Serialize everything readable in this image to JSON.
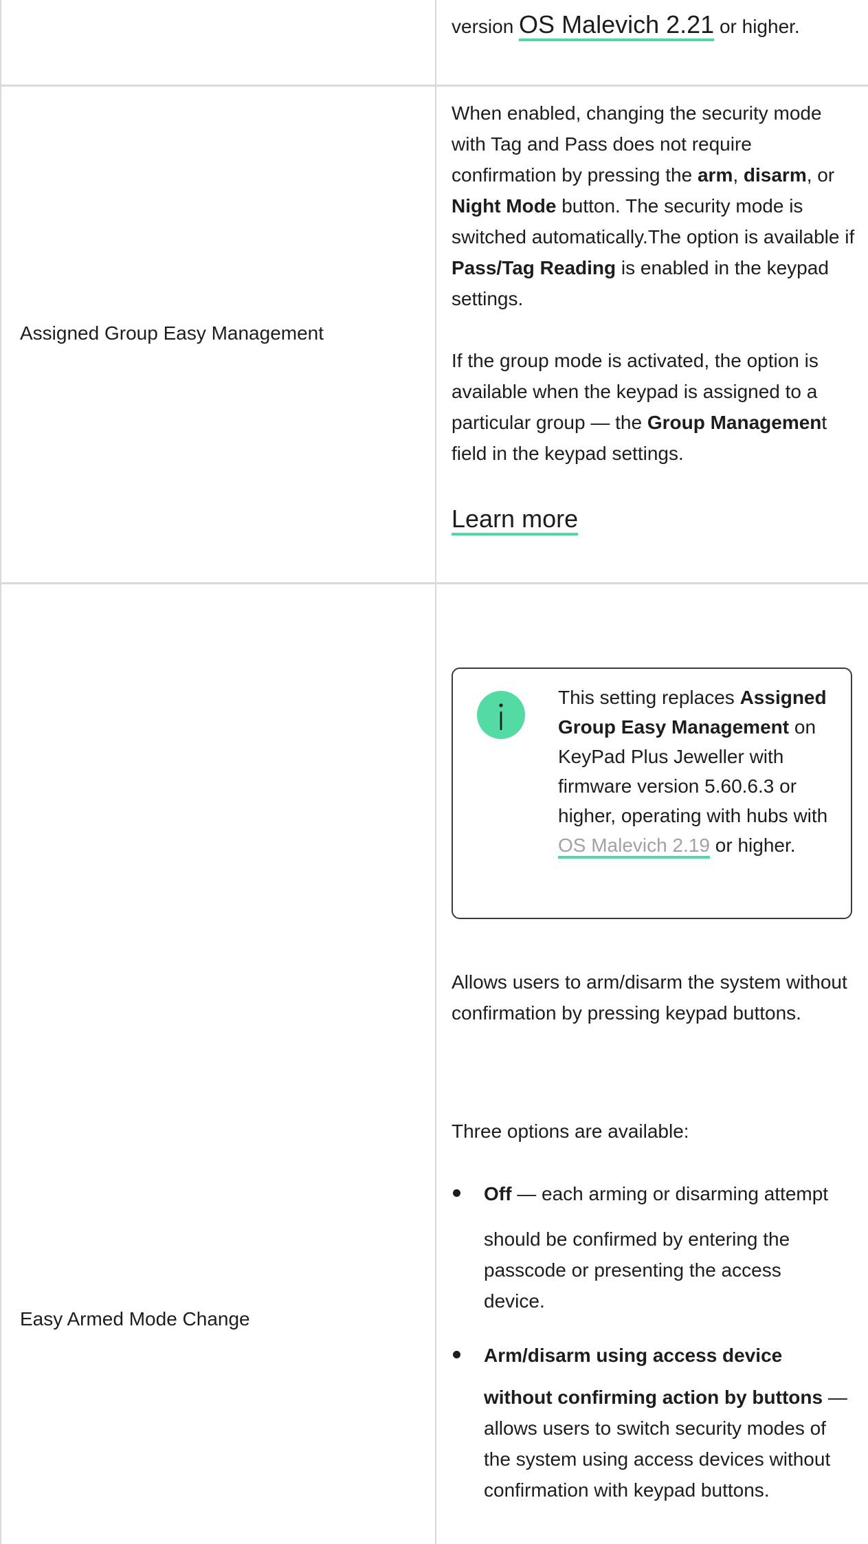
{
  "row1": {
    "prefix": "version ",
    "link": "OS Malevich 2.21",
    "suffix": " or higher."
  },
  "row2": {
    "label": "Assigned Group Easy Management",
    "p1": {
      "t1": "When enabled, changing the security mode with Tag and Pass does not require confirmation by pressing the ",
      "b1": "arm",
      "t2": ", ",
      "b2": "disarm",
      "t3": ", or ",
      "b3": "Night Mode",
      "t4": " button. The security mode is switched automatically.The option is available if ",
      "b4": "Pass/Tag Reading",
      "t5": " is enabled in the keypad settings."
    },
    "p2": {
      "t1": "If the group mode is activated, the option is available when the keypad is assigned to a particular group — the ",
      "b1": "Group Managemen",
      "t2": "t field in the keypad settings."
    },
    "learn_more": "Learn more"
  },
  "row3": {
    "label": "Easy Armed Mode Change",
    "note": {
      "icon": "info-icon",
      "accent_color": "#54dba3",
      "t1": "This setting replaces ",
      "b1": "Assigned Group Easy Management",
      "t2": " on KeyPad Plus Jeweller with firmware version 5.60.6.3 or higher, operating with hubs with ",
      "link": "OS Malevich 2.19",
      "t3": " or higher."
    },
    "intro": "Allows users to arm/disarm the system without confirmation by pressing keypad buttons.",
    "options_intro": "Three options are available:",
    "bullet1": {
      "bold": "Off",
      "line1_rest": " — each arming or disarming attempt",
      "rest": "should be confirmed by entering the passcode or presenting the access device."
    },
    "bullet2": {
      "bold_line1": "Arm/disarm using access device",
      "bold_line2": "without confirming action by buttons",
      "rest": " — allows users to switch security modes of the system using access devices without confirmation with keypad buttons."
    }
  }
}
